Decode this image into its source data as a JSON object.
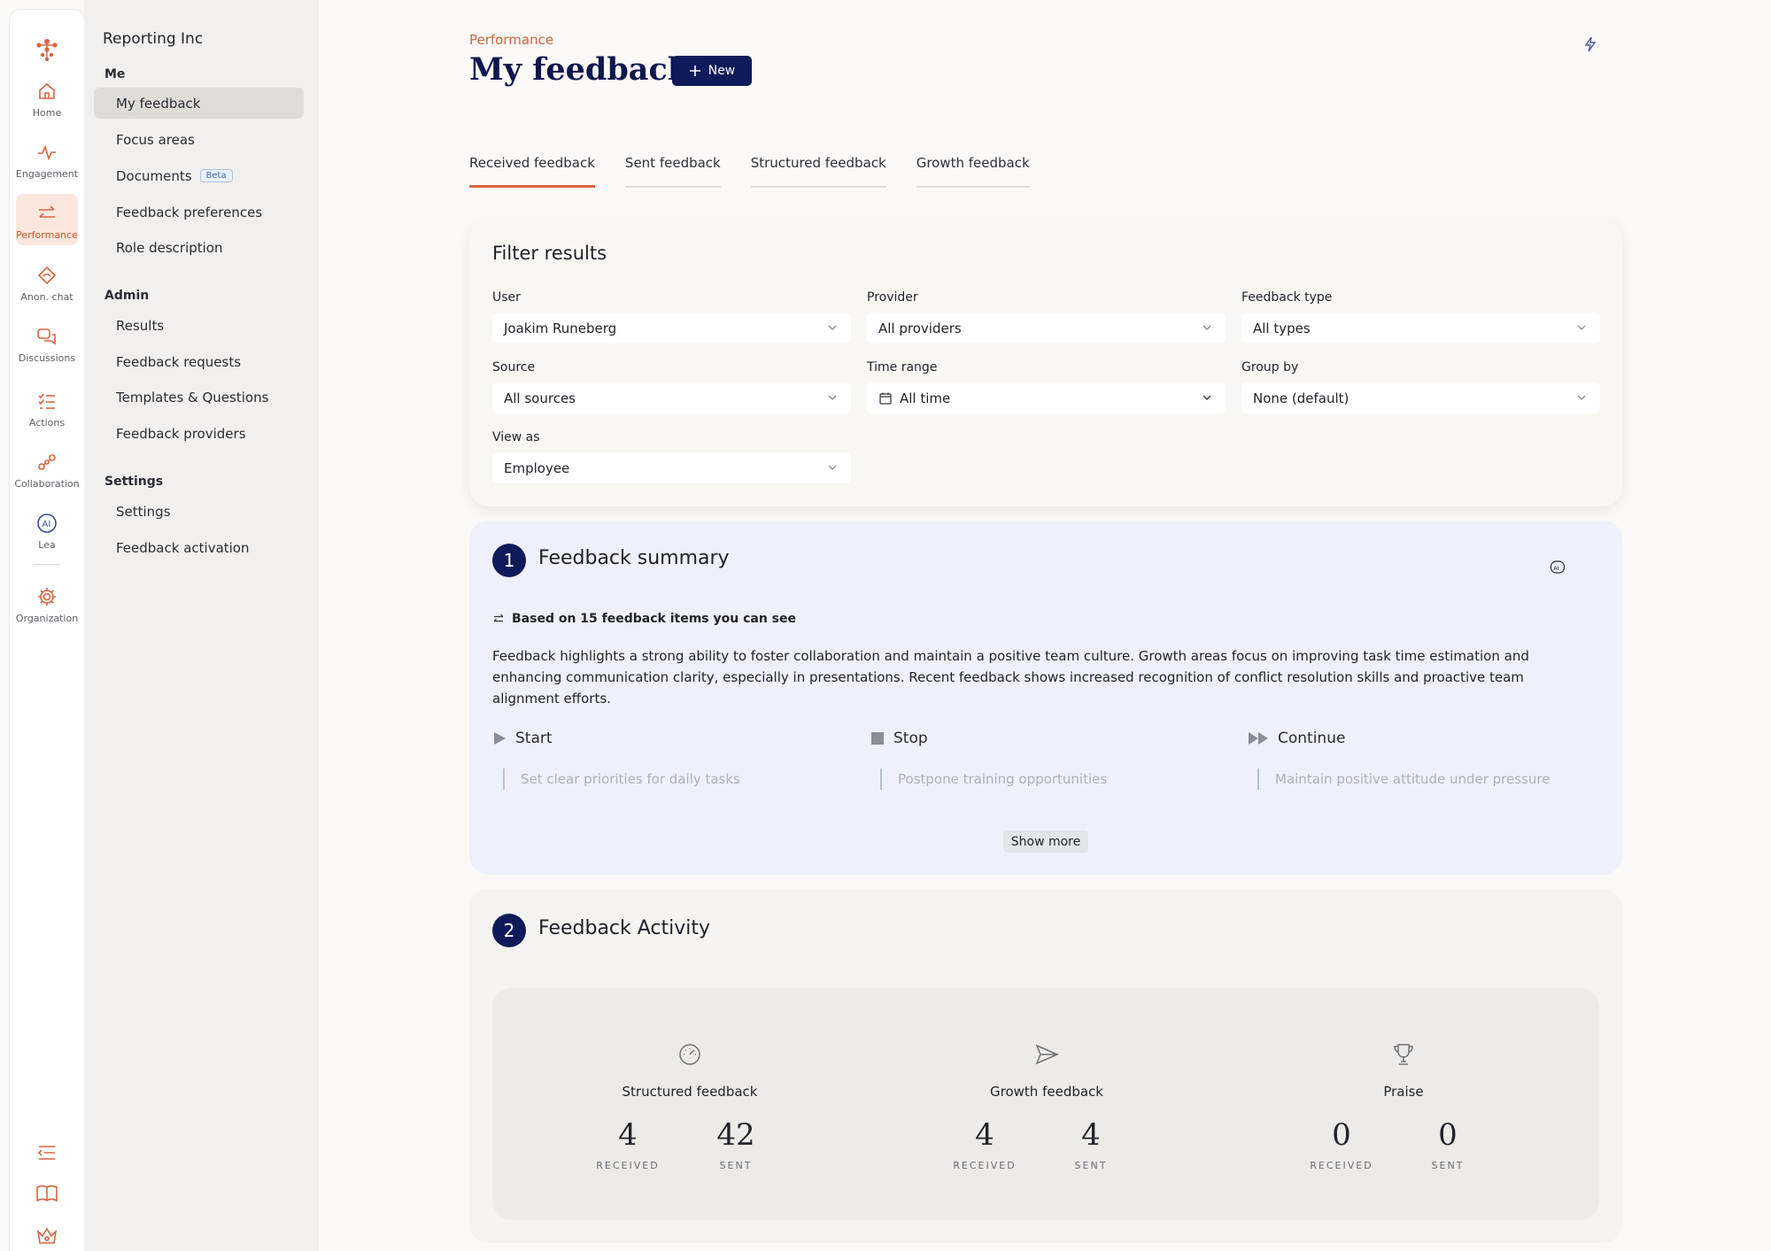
{
  "rail": {
    "items": [
      {
        "label": "Home",
        "icon": "home-icon"
      },
      {
        "label": "Engagement",
        "icon": "pulse-icon"
      },
      {
        "label": "Performance",
        "icon": "arrows-swap-icon",
        "active": true
      },
      {
        "label": "Anon. chat",
        "icon": "anon-chat-icon"
      },
      {
        "label": "Discussions",
        "icon": "chat-bubbles-icon"
      },
      {
        "label": "Actions",
        "icon": "checklist-icon"
      },
      {
        "label": "Collaboration",
        "icon": "network-icon"
      },
      {
        "label": "Lea",
        "icon": "ai-icon"
      },
      {
        "label": "Organization",
        "icon": "gear-icon"
      }
    ],
    "bottom_icons": [
      "collapse-menu-icon",
      "book-icon",
      "crown-icon"
    ]
  },
  "sidebar": {
    "org_name": "Reporting Inc",
    "groups": {
      "me": "Me",
      "admin": "Admin",
      "settings": "Settings"
    },
    "me_items": [
      "My feedback",
      "Focus areas",
      "Documents",
      "Feedback preferences",
      "Role description"
    ],
    "beta_label": "Beta",
    "admin_items": [
      "Results",
      "Feedback requests",
      "Templates & Questions",
      "Feedback providers"
    ],
    "settings_items": [
      "Settings",
      "Feedback activation"
    ]
  },
  "header": {
    "breadcrumb": "Performance",
    "title": "My feedback",
    "new_label": "New"
  },
  "tabs": [
    "Received feedback",
    "Sent feedback",
    "Structured feedback",
    "Growth feedback"
  ],
  "filters": {
    "title": "Filter results",
    "user": {
      "label": "User",
      "value": "Joakim Runeberg"
    },
    "provider": {
      "label": "Provider",
      "value": "All providers"
    },
    "feedback_type": {
      "label": "Feedback type",
      "value": "All types"
    },
    "source": {
      "label": "Source",
      "value": "All sources"
    },
    "time_range": {
      "label": "Time range",
      "value": "All time"
    },
    "group_by": {
      "label": "Group by",
      "value": "None (default)"
    },
    "view_as": {
      "label": "View as",
      "value": "Employee"
    }
  },
  "summary": {
    "number": "1",
    "title": "Feedback summary",
    "based_on": "Based on 15 feedback items you can see",
    "text": "Feedback highlights a strong ability to foster collaboration and maintain a positive team culture. Growth areas focus on improving task time estimation and enhancing communication clarity, especially in presentations. Recent feedback shows increased recognition of conflict resolution skills and proactive team alignment efforts.",
    "start": {
      "label": "Start",
      "item": "Set clear priorities for daily tasks"
    },
    "stop": {
      "label": "Stop",
      "item": "Postpone training opportunities"
    },
    "continue": {
      "label": "Continue",
      "item": "Maintain positive attitude under pressure"
    },
    "show_more": "Show more"
  },
  "activity": {
    "number": "2",
    "title": "Feedback Activity",
    "received_caption": "RECEIVED",
    "sent_caption": "SENT",
    "structured": {
      "label": "Structured feedback",
      "received": "4",
      "sent": "42"
    },
    "growth": {
      "label": "Growth feedback",
      "received": "4",
      "sent": "4"
    },
    "praise": {
      "label": "Praise",
      "received": "0",
      "sent": "0"
    }
  },
  "colors": {
    "accent": "#d9643f",
    "brand_navy": "#0f1a5a",
    "summary_bg": "#eef0fb"
  }
}
